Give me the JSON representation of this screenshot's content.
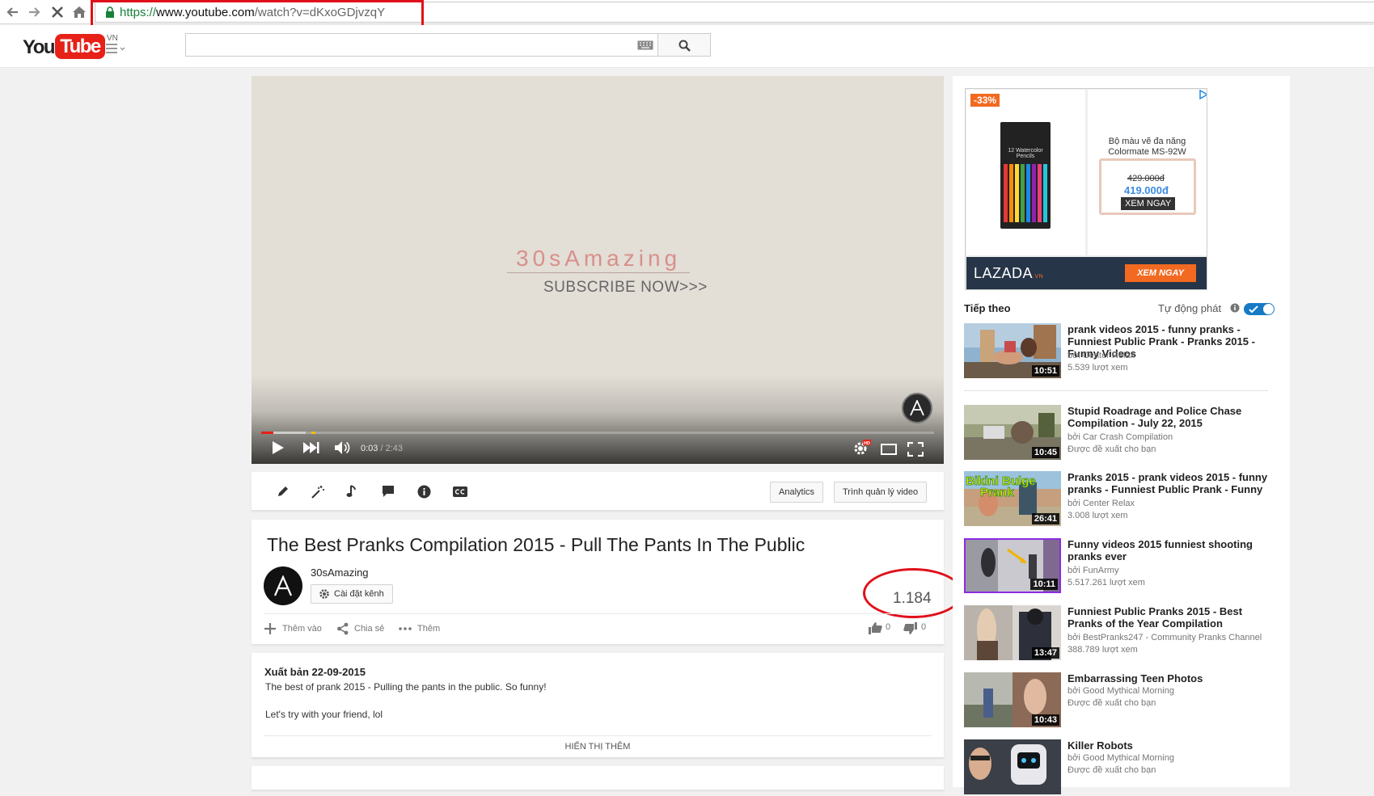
{
  "browser": {
    "url_scheme": "https://",
    "url_host": "www.youtube.com",
    "url_path": "/watch?v=dKxoGDjvzqY"
  },
  "masthead": {
    "logo_you": "You",
    "logo_tube": "Tube",
    "region": "VN",
    "search_placeholder": ""
  },
  "player": {
    "brand": "30sAmazing",
    "subscribe": "SUBSCRIBE NOW>>>",
    "current_time": "0:03",
    "duration": "/ 2:43",
    "progress_fraction": 0.018,
    "buffered_fraction": 0.066,
    "hd_badge": "HD"
  },
  "toolbar": {
    "analytics": "Analytics",
    "video_manager": "Trình quản lý video"
  },
  "video": {
    "title": "The Best Pranks Compilation 2015 - Pull The Pants In The Public",
    "channel": "30sAmazing",
    "channel_settings": "Cài đặt kênh",
    "views": "1.184",
    "add_to": "Thêm vào",
    "share": "Chia sẻ",
    "more": "Thêm",
    "likes": "0",
    "dislikes": "0"
  },
  "description": {
    "published": "Xuất bản 22-09-2015",
    "line1": "The best of prank 2015 - Pulling the pants in the public. So funny!",
    "line2": "Let's try with your friend, lol",
    "show_more": "HIỂN THỊ THÊM"
  },
  "ad": {
    "discount": "-33%",
    "product_label": "12 Watercolor Pencils",
    "product_name": "Bộ màu vẽ đa năng Colormate MS-92W",
    "old_price": "429.000đ",
    "new_price": "419.000đ",
    "cta_small": "XEM NGAY",
    "brand": "LAZADA",
    "brand_suffix": ".VN",
    "cta": "XEM NGAY"
  },
  "sidebar": {
    "up_next": "Tiếp theo",
    "autoplay": "Tự động phát",
    "autoplay_on": true,
    "recommendations": [
      {
        "title": "prank videos 2015 - funny pranks - Funniest Public Prank - Pranks 2015 - Funny Videos",
        "channel": "bởi Center Relax",
        "meta": "5.539 lượt xem",
        "duration": "10:51"
      },
      {
        "title": "Stupid Roadrage and Police Chase Compilation - July 22, 2015",
        "channel": "bởi Car Crash Compilation",
        "meta": "Được đề xuất cho bạn",
        "duration": "10:45"
      },
      {
        "title": "Pranks 2015 - prank videos 2015 - funny pranks - Funniest Public Prank - Funny",
        "channel": "bởi Center Relax",
        "meta": "3.008 lượt xem",
        "duration": "26:41",
        "thumb_text": "Bikini Bulge Prank"
      },
      {
        "title": "Funny videos 2015 funniest shooting pranks ever",
        "channel": "bởi FunArmy",
        "meta": "5.517.261 lượt xem",
        "duration": "10:11"
      },
      {
        "title": "Funniest Public Pranks 2015 - Best Pranks of the Year Compilation",
        "channel": "bởi BestPranks247 - Community Pranks Channel",
        "meta": "388.789 lượt xem",
        "duration": "13:47"
      },
      {
        "title": "Embarrassing Teen Photos",
        "channel": "bởi Good Mythical Morning",
        "meta": "Được đề xuất cho bạn",
        "duration": "10:43"
      },
      {
        "title": "Killer Robots",
        "channel": "bởi Good Mythical Morning",
        "meta": "Được đề xuất cho bạn",
        "duration": ""
      }
    ]
  }
}
